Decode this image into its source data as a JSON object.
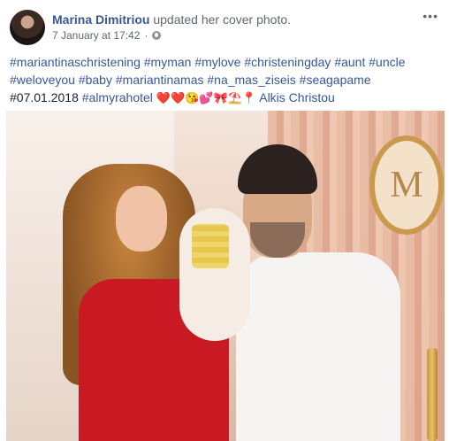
{
  "post": {
    "author": "Marina Dimitriou",
    "action": "updated her cover photo.",
    "timestamp": "7 January at 17:42",
    "separator": "·",
    "menu_label": "•••",
    "privacy_icon": "globe-icon",
    "avatar_icon": "profile-avatar"
  },
  "caption": {
    "hashtags": [
      "#mariantinaschristening",
      "#myman",
      "#mylove",
      "#christeningday",
      "#aunt",
      "#uncle",
      "#weloveyou",
      "#baby",
      "#mariantinamas",
      "#na_mas_ziseis",
      "#seagapame"
    ],
    "date_tag": "#07.01.2018",
    "last_tag": "#almyrahotel",
    "emojis": "❤️❤️😘💕🎀⛱️📍",
    "location": "Alkis Christou"
  },
  "photo": {
    "frame_letter": "M"
  },
  "colors": {
    "link": "#365899",
    "text": "#1d2129",
    "secondary": "#616770"
  }
}
